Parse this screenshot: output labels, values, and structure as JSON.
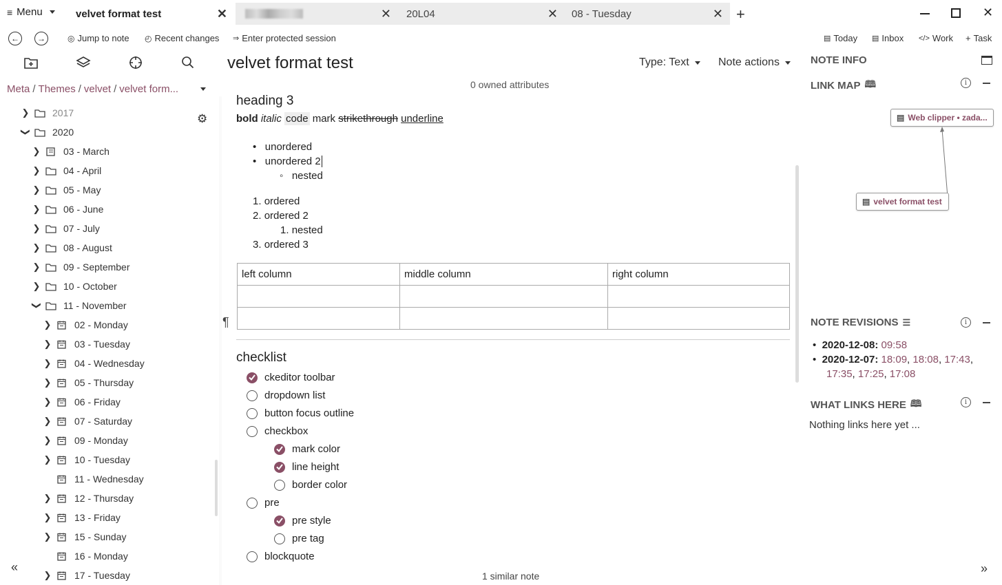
{
  "titlebar": {
    "menu_label": "Menu",
    "tabs": [
      {
        "label": "velvet format test",
        "active": true
      },
      {
        "label": "",
        "active": false
      },
      {
        "label": "20L04",
        "active": false
      },
      {
        "label": "08 - Tuesday",
        "active": false
      }
    ],
    "new_tab": "+"
  },
  "toolbar": {
    "jump": "Jump to note",
    "recent": "Recent changes",
    "protected": "Enter protected session",
    "today": "Today",
    "inbox": "Inbox",
    "work": "Work",
    "task": "Task"
  },
  "breadcrumb": {
    "items": [
      "Meta",
      "Themes",
      "velvet",
      "velvet form..."
    ],
    "sep": "/"
  },
  "tree": {
    "items": [
      {
        "label": "2017",
        "indent": 0,
        "chev": "right",
        "icon": "folder",
        "grey": true
      },
      {
        "label": "2020",
        "indent": 0,
        "chev": "down",
        "icon": "folder"
      },
      {
        "label": "03 - March",
        "indent": 1,
        "chev": "right",
        "icon": "book"
      },
      {
        "label": "04 - April",
        "indent": 1,
        "chev": "right",
        "icon": "folder"
      },
      {
        "label": "05 - May",
        "indent": 1,
        "chev": "right",
        "icon": "folder"
      },
      {
        "label": "06 - June",
        "indent": 1,
        "chev": "right",
        "icon": "folder"
      },
      {
        "label": "07 - July",
        "indent": 1,
        "chev": "right",
        "icon": "folder"
      },
      {
        "label": "08 - August",
        "indent": 1,
        "chev": "right",
        "icon": "folder"
      },
      {
        "label": "09 - September",
        "indent": 1,
        "chev": "right",
        "icon": "folder"
      },
      {
        "label": "10 - October",
        "indent": 1,
        "chev": "right",
        "icon": "folder"
      },
      {
        "label": "11 - November",
        "indent": 1,
        "chev": "down",
        "icon": "folder"
      },
      {
        "label": "02 - Monday",
        "indent": 2,
        "chev": "right",
        "icon": "calendar"
      },
      {
        "label": "03 - Tuesday",
        "indent": 2,
        "chev": "right",
        "icon": "calendar"
      },
      {
        "label": "04 - Wednesday",
        "indent": 2,
        "chev": "right",
        "icon": "calendar"
      },
      {
        "label": "05 - Thursday",
        "indent": 2,
        "chev": "right",
        "icon": "calendar"
      },
      {
        "label": "06 - Friday",
        "indent": 2,
        "chev": "right",
        "icon": "calendar"
      },
      {
        "label": "07 - Saturday",
        "indent": 2,
        "chev": "right",
        "icon": "calendar"
      },
      {
        "label": "09 - Monday",
        "indent": 2,
        "chev": "right",
        "icon": "calendar"
      },
      {
        "label": "10 - Tuesday",
        "indent": 2,
        "chev": "right",
        "icon": "calendar"
      },
      {
        "label": "11 - Wednesday",
        "indent": 2,
        "chev": "none",
        "icon": "calendar"
      },
      {
        "label": "12 - Thursday",
        "indent": 2,
        "chev": "right",
        "icon": "calendar"
      },
      {
        "label": "13 - Friday",
        "indent": 2,
        "chev": "right",
        "icon": "calendar"
      },
      {
        "label": "15 - Sunday",
        "indent": 2,
        "chev": "right",
        "icon": "calendar"
      },
      {
        "label": "16 - Monday",
        "indent": 2,
        "chev": "none",
        "icon": "calendar"
      },
      {
        "label": "17 - Tuesday",
        "indent": 2,
        "chev": "right",
        "icon": "calendar"
      }
    ]
  },
  "note": {
    "title": "velvet format test",
    "type_label": "Type: Text",
    "actions_label": "Note actions",
    "owned_attributes": "0 owned attributes",
    "heading": "heading 3",
    "fmt": {
      "bold": "bold",
      "italic": "italic",
      "code": "code",
      "mark": "mark",
      "strike": "strikethrough",
      "underline": "underline"
    },
    "ul": [
      "unordered",
      "unordered 2",
      "nested"
    ],
    "ol": [
      "ordered",
      "ordered 2",
      "nested",
      "ordered 3"
    ],
    "ol_nums": [
      "1.",
      "2.",
      "1.",
      "3."
    ],
    "table_headers": [
      "left column",
      "middle column",
      "right column"
    ],
    "pilcrow": "¶",
    "checklist_title": "checklist",
    "checklist": [
      {
        "label": "ckeditor toolbar",
        "checked": true,
        "level": 0
      },
      {
        "label": "dropdown list",
        "checked": false,
        "level": 0
      },
      {
        "label": "button focus outline",
        "checked": false,
        "level": 0
      },
      {
        "label": "checkbox",
        "checked": false,
        "level": 0
      },
      {
        "label": "mark color",
        "checked": true,
        "level": 1
      },
      {
        "label": "line height",
        "checked": true,
        "level": 1
      },
      {
        "label": "border color",
        "checked": false,
        "level": 1
      },
      {
        "label": "pre",
        "checked": false,
        "level": 0
      },
      {
        "label": "pre style",
        "checked": true,
        "level": 1
      },
      {
        "label": "pre tag",
        "checked": false,
        "level": 1
      },
      {
        "label": "blockquote",
        "checked": false,
        "level": 0
      }
    ],
    "similar": "1 similar note"
  },
  "right": {
    "note_info": "NOTE INFO",
    "link_map": "LINK MAP",
    "node_web": "Web clipper • zada...",
    "node_self": "velvet format test",
    "note_revisions": "NOTE REVISIONS",
    "rev1_date": "2020-12-08:",
    "rev1_times": [
      "09:58"
    ],
    "rev2_date": "2020-12-07:",
    "rev2_times_line1": [
      "18:09",
      "18:08",
      "17:43"
    ],
    "rev2_times_line2": [
      "17:35",
      "17:25",
      "17:08"
    ],
    "what_links": "WHAT LINKS HERE",
    "nothing_links": "Nothing links here yet ..."
  },
  "colors": {
    "accent": "#8a4f66"
  }
}
